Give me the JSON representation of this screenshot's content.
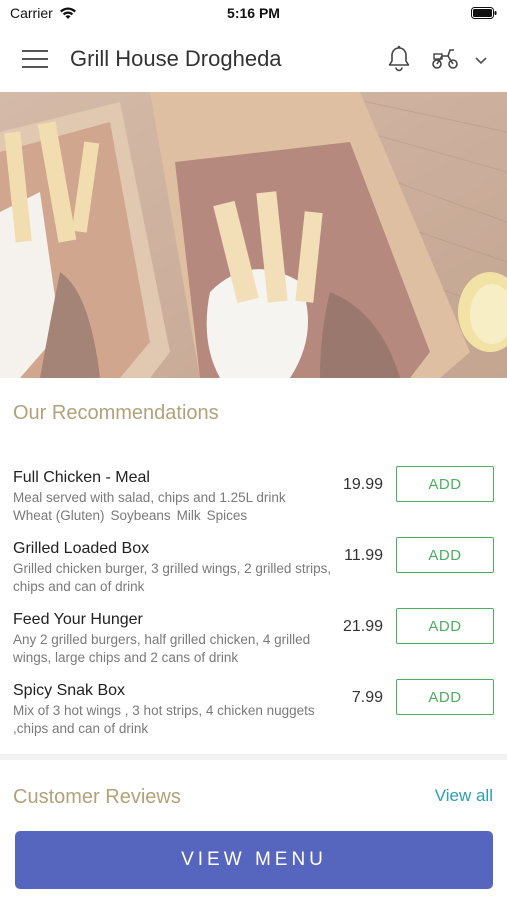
{
  "status_bar": {
    "carrier": "Carrier",
    "time": "5:16 PM"
  },
  "header": {
    "title": "Grill House Drogheda",
    "icons": [
      "menu-icon",
      "bell-icon",
      "scooter-icon",
      "chevron-down-icon"
    ]
  },
  "hero": {
    "icon": "hero-food-image"
  },
  "recommendations": {
    "title": "Our Recommendations",
    "add_label": "ADD",
    "items": [
      {
        "name": "Full Chicken - Meal",
        "description": "Meal served with salad, chips and 1.25L drink",
        "allergens": [
          "Wheat (Gluten)",
          "Soybeans",
          "Milk",
          "Spices"
        ],
        "price": "19.99"
      },
      {
        "name": "Grilled Loaded Box",
        "description": "Grilled chicken burger, 3 grilled wings, 2 grilled strips, chips and can of drink",
        "allergens": [],
        "price": "11.99"
      },
      {
        "name": "Feed Your Hunger",
        "description": "Any 2 grilled burgers, half grilled chicken, 4 grilled wings, large chips and 2 cans of drink",
        "allergens": [],
        "price": "21.99"
      },
      {
        "name": "Spicy Snak Box",
        "description": "Mix of 3 hot wings , 3 hot strips, 4 chicken nuggets ,chips and can of drink",
        "allergens": [],
        "price": "7.99"
      }
    ]
  },
  "reviews": {
    "title": "Customer Reviews",
    "view_all": "View all"
  },
  "footer": {
    "view_menu": "VIEW MENU"
  },
  "colors": {
    "accent_gold": "#b3a17a",
    "add_green": "#4caf60",
    "link_teal": "#2a9fb5",
    "primary_button": "#5665bd"
  }
}
